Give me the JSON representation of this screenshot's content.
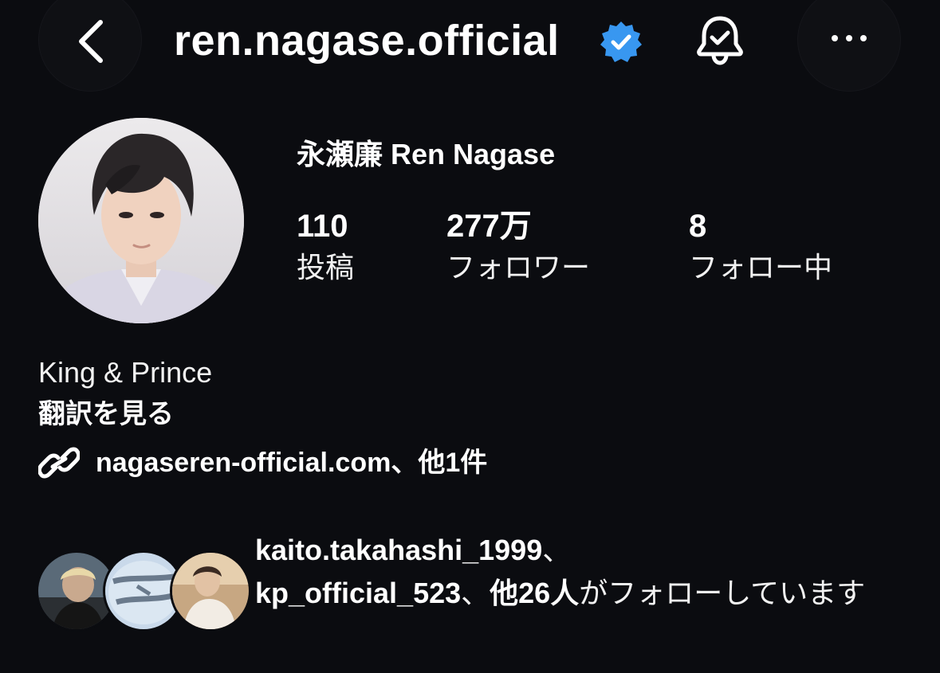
{
  "header": {
    "username": "ren.nagase.official",
    "back_icon": "chevron-left-icon",
    "verified_icon": "verified-badge-icon",
    "verified_color": "#3897f0",
    "bell_icon": "bell-check-icon",
    "more_icon": "more-horizontal-icon"
  },
  "profile": {
    "display_name": "永瀬廉 Ren Nagase",
    "stats": [
      {
        "value": "110",
        "label": "投稿"
      },
      {
        "value": "277万",
        "label": "フォロワー"
      },
      {
        "value": "8",
        "label": "フォロー中"
      }
    ]
  },
  "bio": {
    "category": "King & Prince",
    "translate_label": "翻訳を見る",
    "link_icon": "link-icon",
    "link_text": "nagaseren-official.com、他1件"
  },
  "mutual": {
    "user1": "kaito.takahashi_1999",
    "sep1": "、",
    "user2": "kp_official_523",
    "sep2": "、",
    "others": "他26人",
    "suffix": "がフォローしています"
  }
}
